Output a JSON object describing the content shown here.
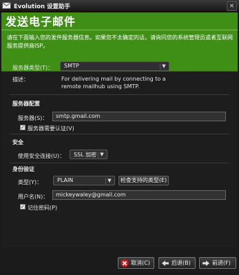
{
  "window": {
    "title": "Evolution 设置助手",
    "close_glyph": "×"
  },
  "header": {
    "title": "发送电子邮件",
    "intro": "请在下面输入您的发件服务器信息。如果您不太确定的话，请询问您的系统管理员或者互联网服务提供商ISP。"
  },
  "server_type": {
    "label": "服务器类型(T)：",
    "value": "SMTP",
    "description_label": "描述：",
    "description": "For delivering mail by connecting to a remote mailhub using SMTP."
  },
  "server_config": {
    "heading": "服务器配置",
    "server_label": "服务器(S)：",
    "server_value": "smtp.gmail.com",
    "auth_required_label": "服务器需要认证(V)",
    "auth_required_checked": true
  },
  "security": {
    "heading": "安全",
    "conn_label": "使用安全连接(U)：",
    "conn_value": "SSL 加密"
  },
  "auth": {
    "heading": "身份验证",
    "type_label": "类型(Y)：",
    "type_value": "PLAIN",
    "check_button": "检查支持的类型(E)",
    "username_label": "用户名(N)：",
    "username_value": "mickeywaley@gmail.com",
    "remember_label": "记住密码(P)",
    "remember_checked": true
  },
  "footer": {
    "cancel": "取消(C)",
    "back": "后退(B)",
    "forward": "前进(F)"
  },
  "icons": {
    "window": "evolution-icon",
    "cancel": "cancel-icon",
    "back": "back-arrow-icon",
    "forward": "forward-arrow-icon",
    "dropdown": "chevron-down-icon"
  },
  "colors": {
    "header_bg": "#3f8e16",
    "window_bg": "#1d1d1d",
    "cancel_icon": "#d11d1d"
  }
}
